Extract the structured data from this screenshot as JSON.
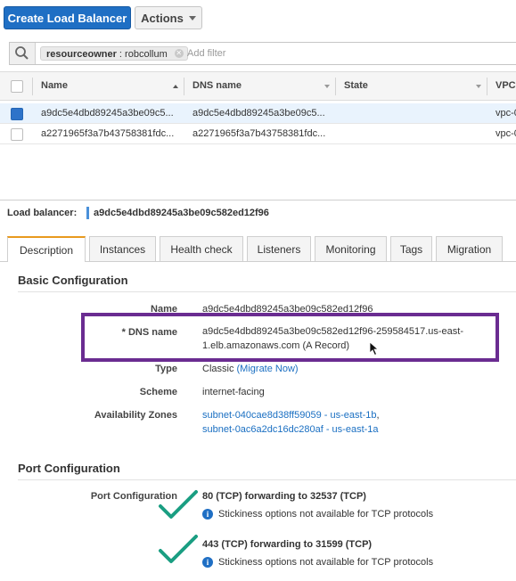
{
  "toolbar": {
    "create_label": "Create Load Balancer",
    "actions_label": "Actions"
  },
  "filter": {
    "chip_key": "resourceowner",
    "chip_sep": " : ",
    "chip_value": "robcollum",
    "placeholder": "Add filter"
  },
  "table": {
    "columns": [
      "Name",
      "DNS name",
      "State",
      "VPC"
    ],
    "rows": [
      {
        "selected": true,
        "name": "a9dc5e4dbd89245a3be09c5...",
        "dns": "a9dc5e4dbd89245a3be09c5...",
        "vpc": "vpc-0"
      },
      {
        "selected": false,
        "name": "a2271965f3a7b43758381fdc...",
        "dns": "a2271965f3a7b43758381fdc...",
        "vpc": "vpc-0"
      }
    ]
  },
  "detail": {
    "title_label": "Load balancer:",
    "title_value": "a9dc5e4dbd89245a3be09c582ed12f96",
    "tabs": [
      "Description",
      "Instances",
      "Health check",
      "Listeners",
      "Monitoring",
      "Tags",
      "Migration"
    ],
    "basic": {
      "heading": "Basic Configuration",
      "name_label": "Name",
      "name_value": "a9dc5e4dbd89245a3be09c582ed12f96",
      "dns_label": "* DNS name",
      "dns_line1": "a9dc5e4dbd89245a3be09c582ed12f96-259584517.us-east-",
      "dns_line2": "1.elb.amazonaws.com (A Record)",
      "type_label": "Type",
      "type_value": "Classic",
      "type_link": "(Migrate Now)",
      "scheme_label": "Scheme",
      "scheme_value": "internet-facing",
      "az_label": "Availability Zones",
      "az_1": "subnet-040cae8d38ff59059 - us-east-1b",
      "az_1_suffix": ",",
      "az_2": "subnet-0ac6a2dc16dc280af - us-east-1a"
    },
    "port": {
      "heading": "Port Configuration",
      "label": "Port Configuration",
      "entries": [
        {
          "rule": "80 (TCP) forwarding to 32537 (TCP)",
          "note": "Stickiness options not available for TCP protocols"
        },
        {
          "rule": "443 (TCP) forwarding to 31599 (TCP)",
          "note": "Stickiness options not available for TCP protocols"
        }
      ]
    }
  },
  "colors": {
    "primary": "#1f6fc4",
    "highlight": "#6a2c91",
    "check": "#1a9e82",
    "tab_accent": "#e89a1e"
  },
  "icons": [
    "search-icon",
    "chip-close-icon",
    "sort-asc-icon",
    "sort-desc-icon",
    "info-icon",
    "checkmark-icon",
    "mouse-cursor-icon",
    "caret-down-icon"
  ]
}
